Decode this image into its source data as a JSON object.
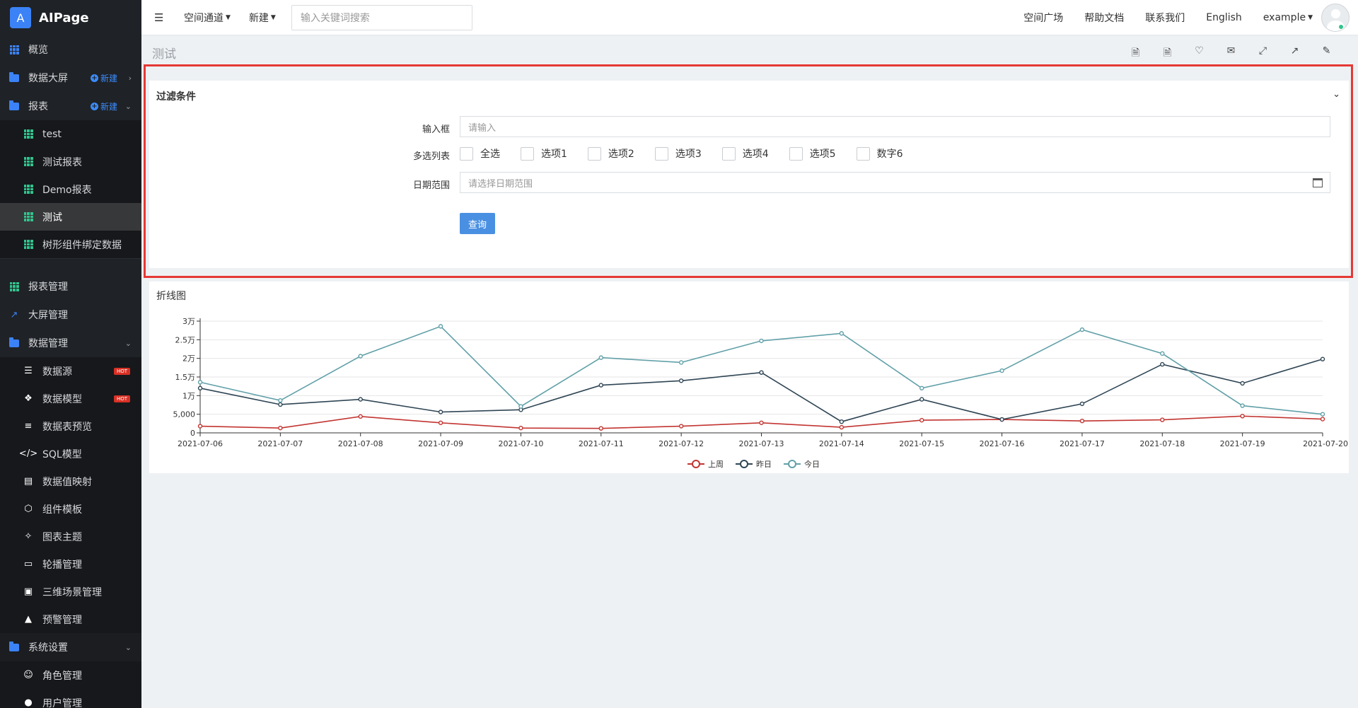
{
  "app": {
    "logo_letter": "A",
    "name": "AIPage"
  },
  "sidebar": {
    "items": [
      {
        "label": "概览"
      },
      {
        "label": "数据大屏",
        "new_label": "新建"
      },
      {
        "label": "报表",
        "new_label": "新建"
      }
    ],
    "report_items": [
      {
        "label": "test"
      },
      {
        "label": "测试报表"
      },
      {
        "label": "Demo报表"
      },
      {
        "label": "测试"
      },
      {
        "label": "树形组件绑定数据"
      }
    ],
    "manage_items": [
      {
        "label": "报表管理"
      },
      {
        "label": "大屏管理"
      },
      {
        "label": "数据管理"
      }
    ],
    "data_items": [
      {
        "label": "数据源",
        "badge": "HOT"
      },
      {
        "label": "数据模型",
        "badge": "HOT"
      },
      {
        "label": "数据表预览"
      },
      {
        "label": "SQL模型"
      },
      {
        "label": "数据值映射"
      },
      {
        "label": "组件模板"
      },
      {
        "label": "图表主题"
      },
      {
        "label": "轮播管理"
      },
      {
        "label": "三维场景管理"
      },
      {
        "label": "预警管理"
      }
    ],
    "settings": {
      "label": "系统设置"
    },
    "settings_items": [
      {
        "label": "角色管理"
      },
      {
        "label": "用户管理"
      }
    ]
  },
  "topbar": {
    "menu_space": "空间通道",
    "menu_new": "新建",
    "search_placeholder": "输入关键词搜索",
    "links": [
      "空间广场",
      "帮助文档",
      "联系我们",
      "English"
    ],
    "user": "example"
  },
  "page": {
    "title": "测试"
  },
  "filter": {
    "title": "过滤条件",
    "input_label": "输入框",
    "input_placeholder": "请输入",
    "checkbox_label": "多选列表",
    "options": [
      "全选",
      "选项1",
      "选项2",
      "选项3",
      "选项4",
      "选项5",
      "数字6"
    ],
    "date_label": "日期范围",
    "date_placeholder": "请选择日期范围",
    "query_button": "查询"
  },
  "chart": {
    "panel_title": "折线图"
  },
  "chart_data": {
    "type": "line",
    "title": "",
    "x": [
      "2021-07-06",
      "2021-07-07",
      "2021-07-08",
      "2021-07-09",
      "2021-07-10",
      "2021-07-11",
      "2021-07-12",
      "2021-07-13",
      "2021-07-14",
      "2021-07-15",
      "2021-07-16",
      "2021-07-17",
      "2021-07-18",
      "2021-07-19",
      "2021-07-20"
    ],
    "y_ticks": [
      "0",
      "5,000",
      "1万",
      "1.5万",
      "2万",
      "2.5万",
      "3万"
    ],
    "ylim": [
      0,
      30000
    ],
    "grid": true,
    "legend_position": "bottom-center",
    "series": [
      {
        "name": "上周",
        "color": "#c23531",
        "values": [
          1800,
          1300,
          4400,
          2700,
          1300,
          1200,
          1800,
          2700,
          1500,
          3400,
          3600,
          3200,
          3500,
          4500,
          3700
        ]
      },
      {
        "name": "昨日",
        "color": "#2f4554",
        "values": [
          12000,
          7600,
          9000,
          5600,
          6200,
          12800,
          14000,
          16200,
          3000,
          9000,
          3600,
          7800,
          18400,
          13300,
          19800
        ]
      },
      {
        "name": "今日",
        "color": "#61a0a8",
        "values": [
          13600,
          8700,
          20600,
          28600,
          7100,
          20200,
          18900,
          24700,
          26700,
          12000,
          16700,
          27700,
          21300,
          7300,
          5000
        ]
      }
    ]
  }
}
